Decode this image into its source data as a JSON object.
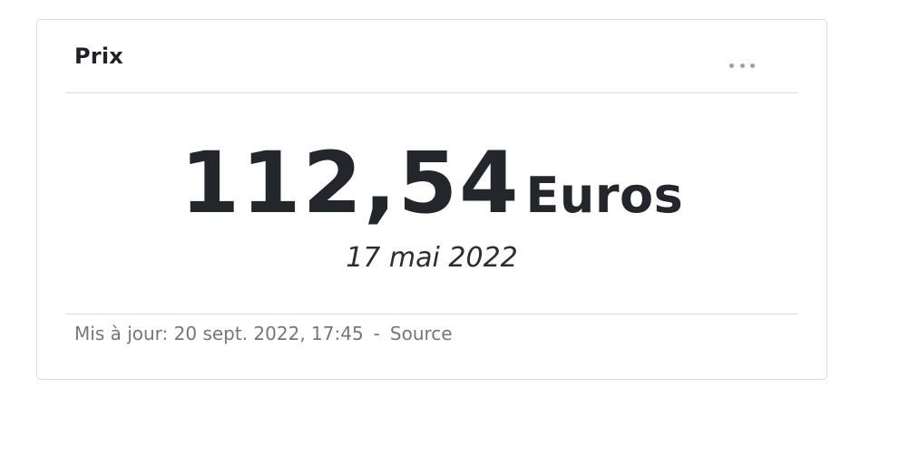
{
  "card": {
    "title": "Prix",
    "menu_icon": "more-horizontal-icon"
  },
  "value": {
    "amount": "112,54",
    "unit": "Euros",
    "date": "17 mai 2022"
  },
  "footer": {
    "updated": "Mis à jour: 20 sept. 2022, 17:45",
    "separator": "-",
    "source_label": "Source"
  }
}
